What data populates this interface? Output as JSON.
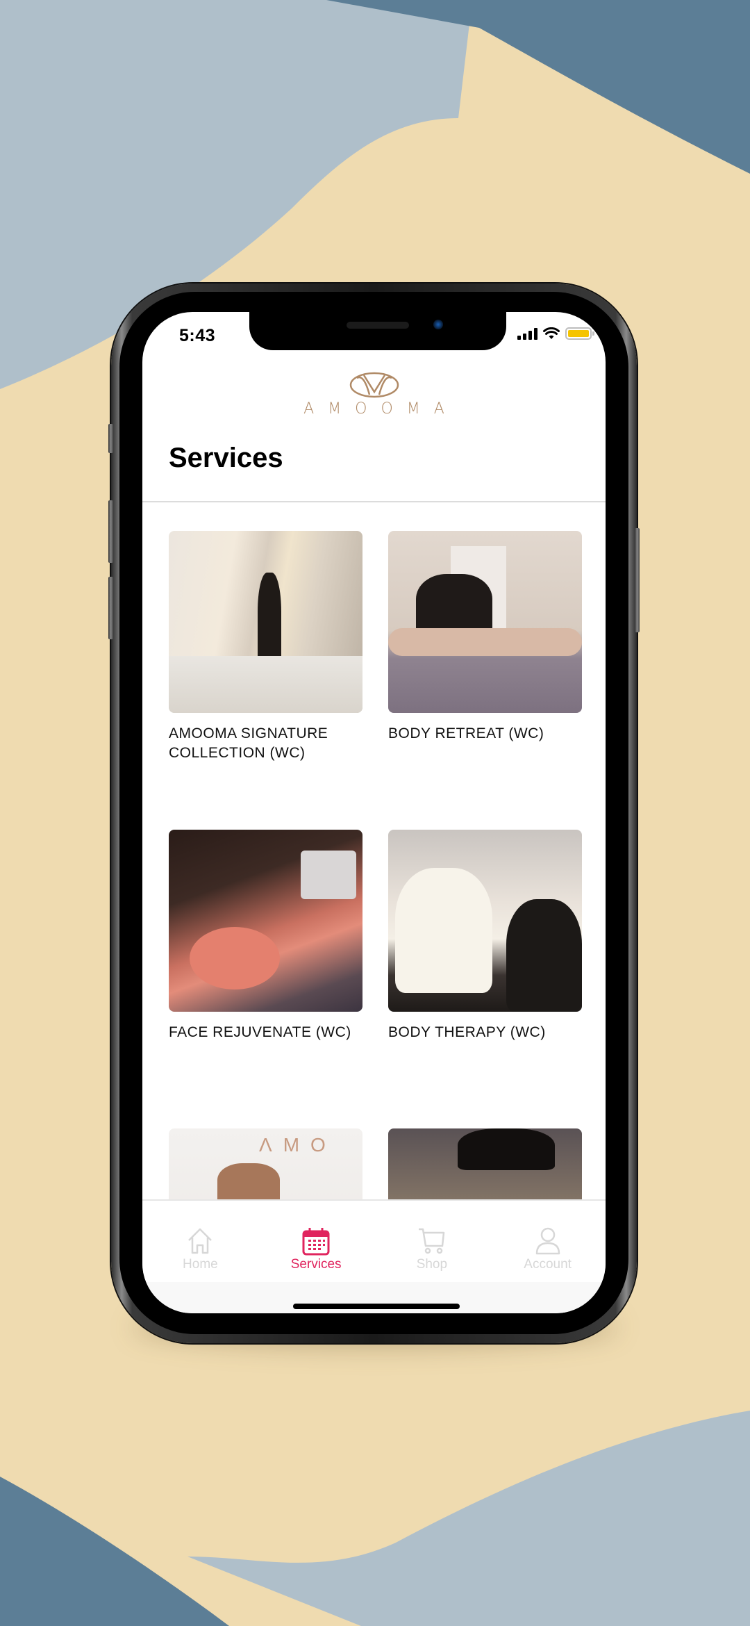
{
  "status_bar": {
    "time": "5:43",
    "battery_level_percent": 100,
    "battery_color": "#f5c400",
    "icons": [
      "cellular-signal-icon",
      "wifi-icon",
      "battery-icon"
    ]
  },
  "brand": {
    "logo_icon": "amooma-logo-icon",
    "wordmark": "AMOOMA",
    "color": "#b08a66"
  },
  "page": {
    "title": "Services"
  },
  "services": [
    {
      "label": "AMOOMA SIGNATURE COLLECTION (WC)",
      "image": "spa-corridor-photo"
    },
    {
      "label": "BODY RETREAT (WC)",
      "image": "back-massage-photo"
    },
    {
      "label": "FACE REJUVENATE (WC)",
      "image": "facial-light-therapy-photo"
    },
    {
      "label": "BODY THERAPY (WC)",
      "image": "foot-treatment-photo"
    },
    {
      "label": "",
      "image": "amooma-wall-photo"
    },
    {
      "label": "",
      "image": "leg-treatment-photo"
    }
  ],
  "tab_bar": {
    "active_color": "#e0245e",
    "inactive_color": "#d7d7d7",
    "tabs": [
      {
        "label": "Home",
        "icon": "home-icon",
        "active": false
      },
      {
        "label": "Services",
        "icon": "calendar-icon",
        "active": true
      },
      {
        "label": "Shop",
        "icon": "cart-icon",
        "active": false
      },
      {
        "label": "Account",
        "icon": "user-icon",
        "active": false
      }
    ]
  },
  "background": {
    "sand": "#efdbb0",
    "light_blue": "#afbfca",
    "dark_blue": "#5c7e96"
  }
}
